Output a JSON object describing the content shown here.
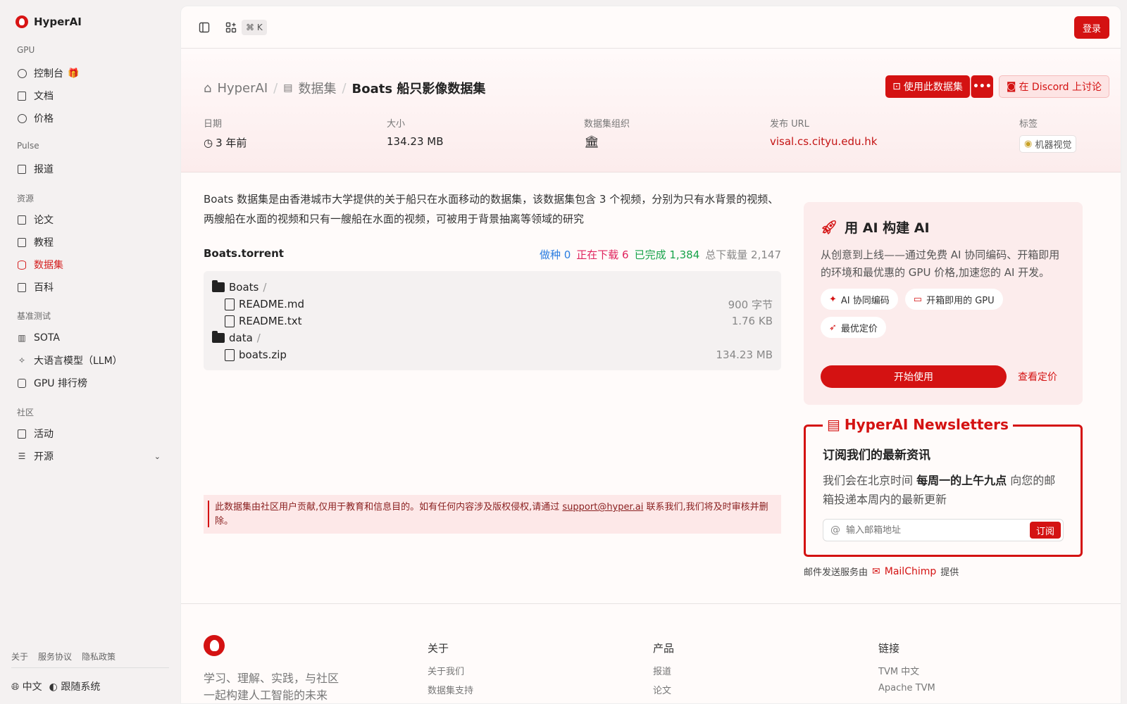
{
  "brand": {
    "name": "HyperAI"
  },
  "sidebar": {
    "groups": [
      {
        "label": "GPU",
        "items": [
          {
            "label": "控制台",
            "icon": "gauge-icon",
            "badge": "gift-icon"
          },
          {
            "label": "文档",
            "icon": "doc-icon"
          },
          {
            "label": "价格",
            "icon": "dollar-icon"
          }
        ]
      },
      {
        "label": "Pulse",
        "items": [
          {
            "label": "报道",
            "icon": "newspaper-icon"
          }
        ]
      },
      {
        "label": "资源",
        "items": [
          {
            "label": "论文",
            "icon": "paper-icon"
          },
          {
            "label": "教程",
            "icon": "book-icon"
          },
          {
            "label": "数据集",
            "icon": "database-icon",
            "active": true
          },
          {
            "label": "百科",
            "icon": "wiki-icon"
          }
        ]
      },
      {
        "label": "基准测试",
        "items": [
          {
            "label": "SOTA",
            "icon": "bar-chart-icon"
          },
          {
            "label": "大语言模型（LLM）",
            "icon": "sparkles-icon"
          },
          {
            "label": "GPU 排行榜",
            "icon": "chip-icon"
          }
        ]
      },
      {
        "label": "社区",
        "items": [
          {
            "label": "活动",
            "icon": "calendar-icon"
          },
          {
            "label": "开源",
            "icon": "list-icon"
          }
        ]
      }
    ],
    "footer_links": [
      "关于",
      "服务协议",
      "隐私政策"
    ],
    "language": "中文",
    "theme": "跟随系统"
  },
  "topbar": {
    "shortcut": "⌘ K",
    "login_label": "登录"
  },
  "breadcrumb": {
    "home": "HyperAI",
    "section": "数据集",
    "current": "Boats 船只影像数据集"
  },
  "actions": {
    "use_dataset": "使用此数据集",
    "more": "•••",
    "discord": "在 Discord 上讨论"
  },
  "meta": {
    "date_label": "日期",
    "date_value": "3 年前",
    "size_label": "大小",
    "size_value": "134.23 MB",
    "org_label": "数据集组织",
    "url_label": "发布 URL",
    "url_value": "visal.cs.cityu.edu.hk",
    "tag_label": "标签",
    "tag_value": "机器视觉"
  },
  "description": "Boats 数据集是由香港城市大学提供的关于船只在水面移动的数据集，该数据集包含 3 个视频，分别为只有水背景的视频、两艘船在水面的视频和只有一艘船在水面的视频，可被用于背景抽离等领域的研究",
  "torrent": {
    "name": "Boats.torrent",
    "seeding": "做种 0",
    "downloading": "正在下载 6",
    "completed": "已完成 1,384",
    "total": "总下载量 2,147",
    "files": [
      {
        "name": "Boats",
        "type": "folder",
        "size": ""
      },
      {
        "name": "README.md",
        "type": "file",
        "size": "900 字节"
      },
      {
        "name": "README.txt",
        "type": "file",
        "size": "1.76 KB"
      },
      {
        "name": "data",
        "type": "folder",
        "size": ""
      },
      {
        "name": "boats.zip",
        "type": "file",
        "size": "134.23 MB"
      }
    ]
  },
  "notice": {
    "before": "此数据集由社区用户贡献,仅用于教育和信息目的。如有任何内容涉及版权侵权,请通过 ",
    "email": "support@hyper.ai",
    "after": " 联系我们,我们将及时审核并删除。"
  },
  "promo": {
    "title": "用 AI 构建 AI",
    "text": "从创意到上线——通过免费 AI 协同编码、开箱即用的环境和最优惠的 GPU 价格,加速您的 AI 开发。",
    "chips": [
      "AI 协同编码",
      "开箱即用的 GPU",
      "最优定价"
    ],
    "start": "开始使用",
    "pricing": "查看定价"
  },
  "newsletter": {
    "title": "HyperAI Newsletters",
    "heading": "订阅我们的最新资讯",
    "text_before": "我们会在北京时间 ",
    "text_bold": "每周一的上午九点",
    "text_after": " 向您的邮箱投递本周内的最新更新",
    "placeholder": "输入邮箱地址",
    "subscribe": "订阅",
    "provider_before": "邮件发送服务由",
    "provider": "MailChimp",
    "provider_after": "提供"
  },
  "footer": {
    "slogan": "学习、理解、实践，与社区一起构建人工智能的未来",
    "cols": [
      {
        "title": "关于",
        "items": [
          "关于我们",
          "数据集支持"
        ]
      },
      {
        "title": "产品",
        "items": [
          "报道",
          "论文"
        ]
      },
      {
        "title": "链接",
        "items": [
          "TVM 中文",
          "Apache TVM"
        ]
      }
    ]
  },
  "colors": {
    "accent": "#d41212",
    "background": "#f4f1f1",
    "panel": "#fffbfa"
  }
}
